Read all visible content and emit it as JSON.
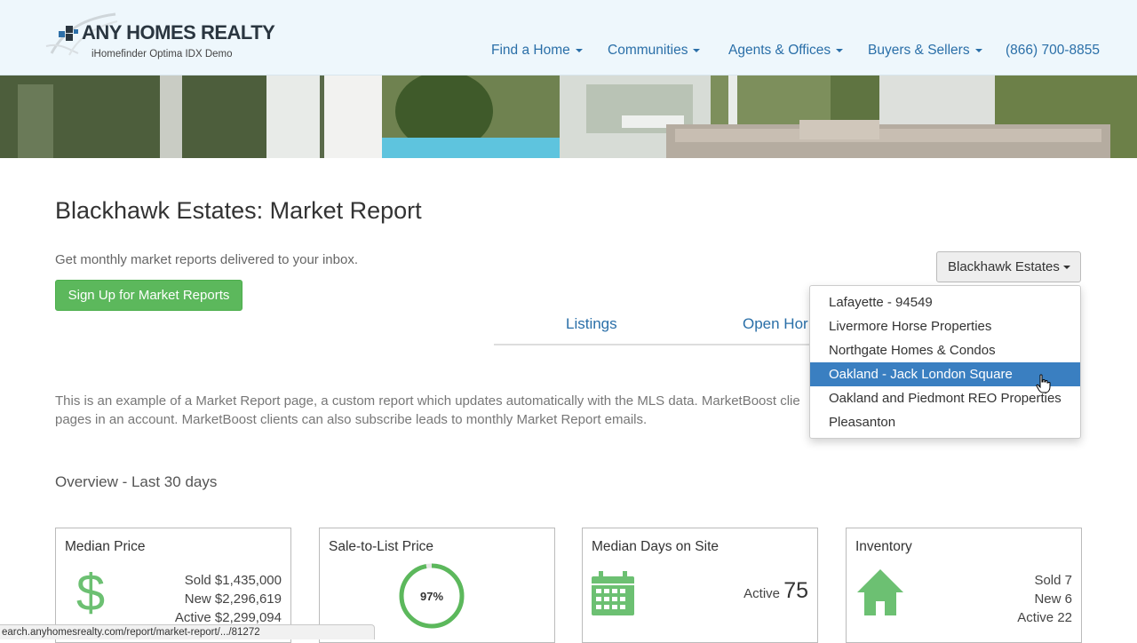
{
  "header": {
    "brand": "ANY HOMES REALTY",
    "tagline": "iHomefinder Optima IDX Demo",
    "nav": [
      {
        "label": "Find a Home"
      },
      {
        "label": "Communities"
      },
      {
        "label": "Agents & Offices"
      },
      {
        "label": "Buyers & Sellers"
      }
    ],
    "phone": "(866) 700-8855"
  },
  "page": {
    "title": "Blackhawk Estates: Market Report",
    "signup_text": "Get monthly market reports delivered to your inbox.",
    "signup_button": "Sign Up for Market Reports",
    "tabs": [
      "Listings",
      "Open Hor"
    ],
    "description_line1": "This is an example of a Market Report page, a custom report which updates automatically with the MLS data. MarketBoost clie",
    "description_line2": "pages in an account. MarketBoost clients can also subscribe leads to monthly Market Report emails.",
    "overview_heading": "Overview - Last 30 days"
  },
  "dropdown": {
    "selected": "Blackhawk Estates",
    "items": [
      "Lafayette - 94549",
      "Livermore Horse Properties",
      "Northgate Homes & Condos",
      "Oakland - Jack London Square",
      "Oakland and Piedmont REO Properties",
      "Pleasanton"
    ],
    "highlighted_index": 3
  },
  "cards": {
    "median_price": {
      "title": "Median Price",
      "sold_label": "Sold",
      "sold_value": "$1,435,000",
      "new_label": "New",
      "new_value": "$2,296,619",
      "active_label": "Active",
      "active_value": "$2,299,094"
    },
    "sale_to_list": {
      "title": "Sale-to-List Price",
      "percent_text": "97%",
      "percent": 97
    },
    "median_days": {
      "title": "Median Days on Site",
      "active_label": "Active",
      "active_value": "75"
    },
    "inventory": {
      "title": "Inventory",
      "sold_label": "Sold",
      "sold_value": "7",
      "new_label": "New",
      "new_value": "6",
      "active_label": "Active",
      "active_value": "22"
    }
  },
  "status_bar": "earch.anyhomesrealty.com/report/market-report/.../81272",
  "colors": {
    "header_bg": "#eef7fc",
    "link": "#2a6fa8",
    "green": "#5cb85c",
    "icon_green": "#6cc072",
    "highlight": "#3a7fc1"
  },
  "icons": [
    "logo-mark-icon",
    "dollar-icon",
    "calendar-icon",
    "house-icon",
    "hand-cursor-icon"
  ]
}
